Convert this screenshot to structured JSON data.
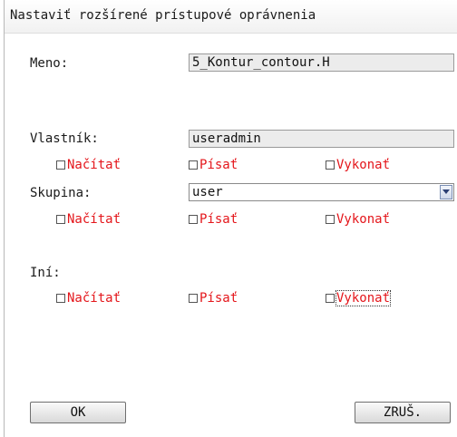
{
  "dialog": {
    "title": "Nastaviť rozšírené prístupové oprávnenia"
  },
  "name": {
    "label": "Meno:",
    "value": "5_Kontur_contour.H"
  },
  "owner": {
    "label": "Vlastník:",
    "value": "useradmin",
    "perms": [
      {
        "label": "Načítať",
        "checked": false
      },
      {
        "label": "Písať",
        "checked": false
      },
      {
        "label": "Vykonať",
        "checked": false
      }
    ]
  },
  "group": {
    "label": "Skupina:",
    "selected": "user",
    "perms": [
      {
        "label": "Načítať",
        "checked": false
      },
      {
        "label": "Písať",
        "checked": false
      },
      {
        "label": "Vykonať",
        "checked": false
      }
    ]
  },
  "other": {
    "label": "Iní:",
    "perms": [
      {
        "label": "Načítať",
        "checked": false
      },
      {
        "label": "Písať",
        "checked": false
      },
      {
        "label": "Vykonať",
        "checked": false
      }
    ]
  },
  "buttons": {
    "ok": "OK",
    "cancel": "ZRUŠ."
  },
  "colors": {
    "permission_label": "#e4161b",
    "field_background": "#ececec"
  },
  "icons": {
    "select_arrow": "chevron-down-icon"
  }
}
